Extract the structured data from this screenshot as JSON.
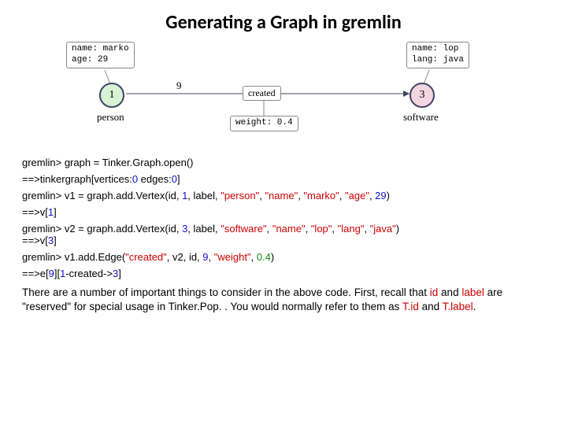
{
  "title": "Generating a Graph in gremlin",
  "diagram": {
    "v1": {
      "id": "1",
      "label": "person",
      "props": "name: marko\nage: 29"
    },
    "v3": {
      "id": "3",
      "label": "software",
      "props": "name: lop\nlang: java"
    },
    "edge": {
      "id": "9",
      "label": "created",
      "weight_tag": "weight: 0.4"
    }
  },
  "code": {
    "l1": "gremlin> graph = Tinker.Graph.open()",
    "l2": "==>tinkergraph[vertices:",
    "l2a": "0",
    "l2b": " edges:",
    "l2c": "0",
    "l2d": "]",
    "l3": "gremlin> v1 = graph.add.Vertex(id, ",
    "l3a": "1",
    "l3b": ", label, ",
    "l3c": "\"person\"",
    "l3d": ", ",
    "l3e": "\"name\"",
    "l3f": ", ",
    "l3g": "\"marko\"",
    "l3h": ", ",
    "l3i": "\"age\"",
    "l3j": ", ",
    "l3k": "29",
    "l3l": ")",
    "l4": "==>v[",
    "l4a": "1",
    "l4b": "]",
    "l5": "gremlin> v2 = graph.add.Vertex(id, ",
    "l5a": "3",
    "l5b": ", label, ",
    "l5c": "\"software\"",
    "l5d": ", ",
    "l5e": "\"name\"",
    "l5f": ", ",
    "l5g": "\"lop\"",
    "l5h": ", ",
    "l5i": "\"lang\"",
    "l5j": ", ",
    "l5k": "\"java\"",
    "l5l": ")",
    "l6": "==>v[",
    "l6a": "3",
    "l6b": "]",
    "l7": "gremlin> v1.add.Edge(",
    "l7a": "\"created\"",
    "l7b": ", v2, id, ",
    "l7c": "9",
    "l7d": ", ",
    "l7e": "\"weight\"",
    "l7f": ", ",
    "l7g": "0.4",
    "l7h": ")",
    "l8": "==>e[",
    "l8a": "9",
    "l8b": "][",
    "l8c": "1",
    "l8d": "-created->",
    "l8e": "3",
    "l8f": "]"
  },
  "prose": {
    "a": "There are a number of important things to consider in the above code. First, recall that ",
    "b": "id",
    "c": " and ",
    "d": "label",
    "e": " are \"reserved\" for special usage in Tinker.Pop. . You would normally refer to them as ",
    "f": "T.id",
    "g": " and ",
    "h": "T.label",
    "i": "."
  }
}
